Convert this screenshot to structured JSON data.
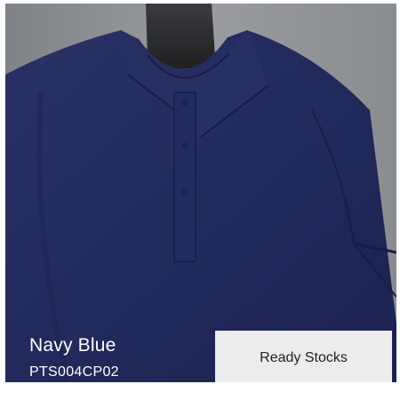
{
  "product": {
    "color_name": "Navy Blue",
    "code": "PTS004CP02",
    "image_icon": "polo-shirt-photo"
  },
  "badge": {
    "label": "Ready Stocks"
  },
  "colors": {
    "shirt": "#222a5c",
    "background": "#8c8f92",
    "badge_bg": "#ececec",
    "caption_text": "#ffffff"
  }
}
